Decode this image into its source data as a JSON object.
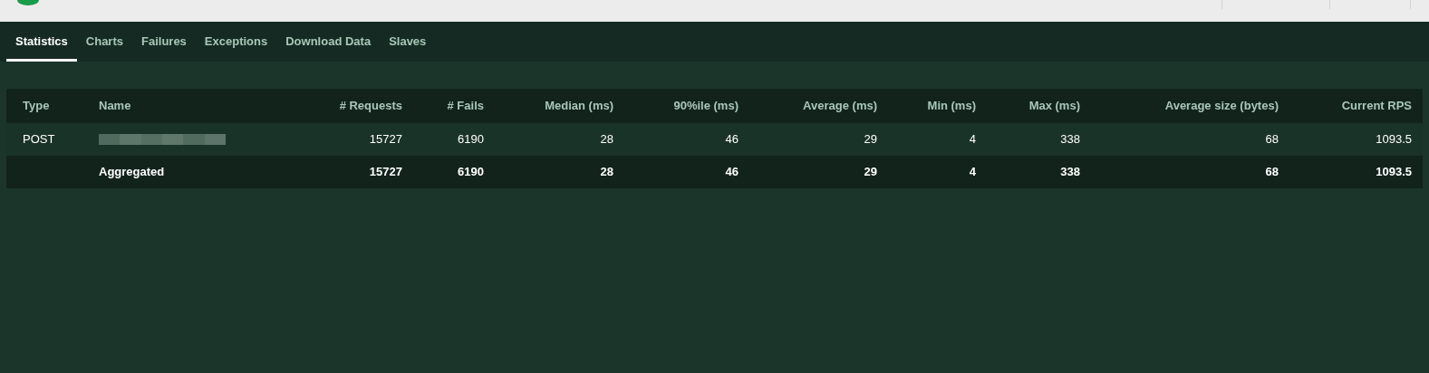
{
  "tabs": [
    {
      "label": "Statistics",
      "selected": true
    },
    {
      "label": "Charts",
      "selected": false
    },
    {
      "label": "Failures",
      "selected": false
    },
    {
      "label": "Exceptions",
      "selected": false
    },
    {
      "label": "Download Data",
      "selected": false
    },
    {
      "label": "Slaves",
      "selected": false
    }
  ],
  "table": {
    "columns": [
      "Type",
      "Name",
      "# Requests",
      "# Fails",
      "Median (ms)",
      "90%ile (ms)",
      "Average (ms)",
      "Min (ms)",
      "Max (ms)",
      "Average size (bytes)",
      "Current RPS"
    ],
    "rows": [
      {
        "kind": "request",
        "cells": [
          "POST",
          "",
          "15727",
          "6190",
          "28",
          "46",
          "29",
          "4",
          "338",
          "68",
          "1093.5"
        ]
      },
      {
        "kind": "total",
        "cells": [
          "",
          "Aggregated",
          "15727",
          "6190",
          "28",
          "46",
          "29",
          "4",
          "338",
          "68",
          "1093.5"
        ]
      }
    ]
  }
}
